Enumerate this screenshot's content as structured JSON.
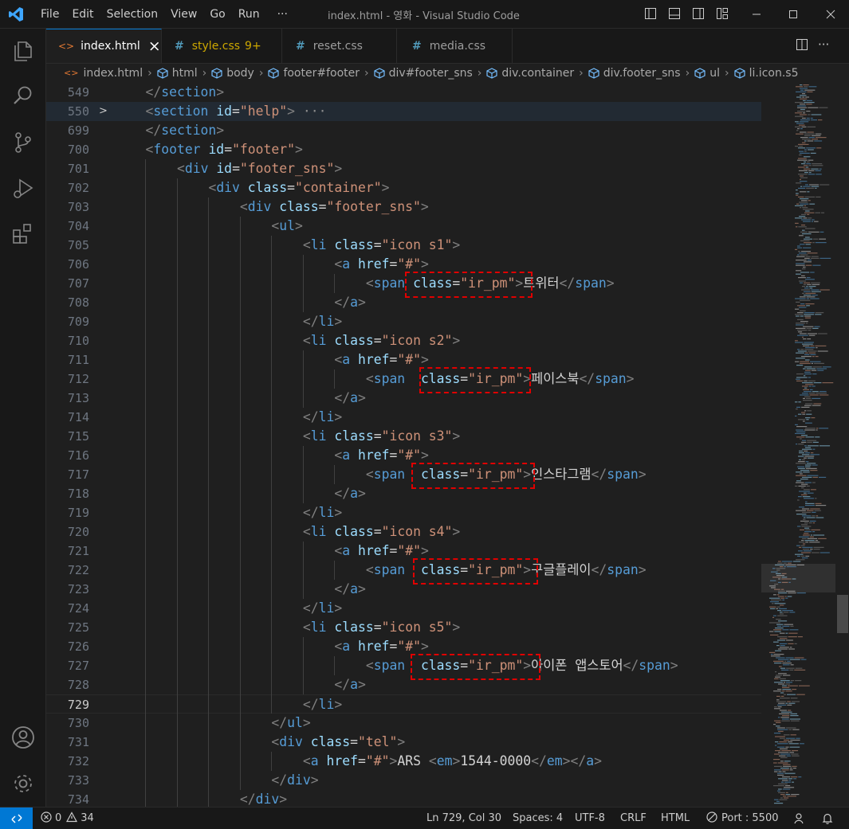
{
  "titlebar": {
    "menu": [
      "File",
      "Edit",
      "Selection",
      "View",
      "Go",
      "Run"
    ],
    "more": "···",
    "window_title": "index.html - 영화 - Visual Studio Code"
  },
  "tabs": [
    {
      "label": "index.html",
      "close": "×"
    },
    {
      "label": "style.css",
      "badge": "9+"
    },
    {
      "label": "reset.css"
    },
    {
      "label": "media.css"
    }
  ],
  "breadcrumb": [
    "index.html",
    "html",
    "body",
    "footer#footer",
    "div#footer_sns",
    "div.container",
    "div.footer_sns",
    "ul",
    "li.icon.s5"
  ],
  "editor": {
    "lines": [
      {
        "n": "549",
        "indent": 1,
        "code": [
          [
            "tg",
            "</"
          ],
          [
            "tn",
            "section"
          ],
          [
            "tg",
            ">"
          ]
        ]
      },
      {
        "n": "550",
        "indent": 1,
        "fold": ">",
        "cur": true,
        "code": [
          [
            "tg",
            "<"
          ],
          [
            "tn",
            "section"
          ],
          [
            "tx",
            " "
          ],
          [
            "at",
            "id"
          ],
          [
            "tx",
            "="
          ],
          [
            "st",
            "\"help\""
          ],
          [
            "tg",
            ">"
          ],
          [
            "el",
            " ···"
          ]
        ]
      },
      {
        "n": "699",
        "indent": 1,
        "code": [
          [
            "tg",
            "</"
          ],
          [
            "tn",
            "section"
          ],
          [
            "tg",
            ">"
          ]
        ]
      },
      {
        "n": "700",
        "indent": 1,
        "code": [
          [
            "tg",
            "<"
          ],
          [
            "tn",
            "footer"
          ],
          [
            "tx",
            " "
          ],
          [
            "at",
            "id"
          ],
          [
            "tx",
            "="
          ],
          [
            "st",
            "\"footer\""
          ],
          [
            "tg",
            ">"
          ]
        ]
      },
      {
        "n": "701",
        "indent": 2,
        "code": [
          [
            "tg",
            "<"
          ],
          [
            "tn",
            "div"
          ],
          [
            "tx",
            " "
          ],
          [
            "at",
            "id"
          ],
          [
            "tx",
            "="
          ],
          [
            "st",
            "\"footer_sns\""
          ],
          [
            "tg",
            ">"
          ]
        ]
      },
      {
        "n": "702",
        "indent": 3,
        "code": [
          [
            "tg",
            "<"
          ],
          [
            "tn",
            "div"
          ],
          [
            "tx",
            " "
          ],
          [
            "at",
            "class"
          ],
          [
            "tx",
            "="
          ],
          [
            "st",
            "\"container\""
          ],
          [
            "tg",
            ">"
          ]
        ]
      },
      {
        "n": "703",
        "indent": 4,
        "code": [
          [
            "tg",
            "<"
          ],
          [
            "tn",
            "div"
          ],
          [
            "tx",
            " "
          ],
          [
            "at",
            "class"
          ],
          [
            "tx",
            "="
          ],
          [
            "st",
            "\"footer_sns\""
          ],
          [
            "tg",
            ">"
          ]
        ]
      },
      {
        "n": "704",
        "indent": 5,
        "code": [
          [
            "tg",
            "<"
          ],
          [
            "tn",
            "ul"
          ],
          [
            "tg",
            ">"
          ]
        ]
      },
      {
        "n": "705",
        "indent": 6,
        "code": [
          [
            "tg",
            "<"
          ],
          [
            "tn",
            "li"
          ],
          [
            "tx",
            " "
          ],
          [
            "at",
            "class"
          ],
          [
            "tx",
            "="
          ],
          [
            "st",
            "\"icon s1\""
          ],
          [
            "tg",
            ">"
          ]
        ]
      },
      {
        "n": "706",
        "indent": 7,
        "code": [
          [
            "tg",
            "<"
          ],
          [
            "tn",
            "a"
          ],
          [
            "tx",
            " "
          ],
          [
            "at",
            "href"
          ],
          [
            "tx",
            "="
          ],
          [
            "st",
            "\"#\""
          ],
          [
            "tg",
            ">"
          ]
        ]
      },
      {
        "n": "707",
        "indent": 8,
        "code": [
          [
            "tg",
            "<"
          ],
          [
            "tn",
            "span"
          ],
          [
            "tx",
            " "
          ],
          [
            "at",
            "class"
          ],
          [
            "tx",
            "="
          ],
          [
            "st",
            "\"ir_pm\""
          ],
          [
            "tg",
            ">"
          ],
          [
            "tx",
            "트위터"
          ],
          [
            "tg",
            "</"
          ],
          [
            "tn",
            "span"
          ],
          [
            "tg",
            ">"
          ]
        ]
      },
      {
        "n": "708",
        "indent": 7,
        "code": [
          [
            "tg",
            "</"
          ],
          [
            "tn",
            "a"
          ],
          [
            "tg",
            ">"
          ]
        ]
      },
      {
        "n": "709",
        "indent": 6,
        "code": [
          [
            "tg",
            "</"
          ],
          [
            "tn",
            "li"
          ],
          [
            "tg",
            ">"
          ]
        ]
      },
      {
        "n": "710",
        "indent": 6,
        "code": [
          [
            "tg",
            "<"
          ],
          [
            "tn",
            "li"
          ],
          [
            "tx",
            " "
          ],
          [
            "at",
            "class"
          ],
          [
            "tx",
            "="
          ],
          [
            "st",
            "\"icon s2\""
          ],
          [
            "tg",
            ">"
          ]
        ]
      },
      {
        "n": "711",
        "indent": 7,
        "code": [
          [
            "tg",
            "<"
          ],
          [
            "tn",
            "a"
          ],
          [
            "tx",
            " "
          ],
          [
            "at",
            "href"
          ],
          [
            "tx",
            "="
          ],
          [
            "st",
            "\"#\""
          ],
          [
            "tg",
            ">"
          ]
        ]
      },
      {
        "n": "712",
        "indent": 8,
        "code": [
          [
            "tg",
            "<"
          ],
          [
            "tn",
            "span"
          ],
          [
            "tx",
            "  "
          ],
          [
            "at",
            "class"
          ],
          [
            "tx",
            "="
          ],
          [
            "st",
            "\"ir_pm\""
          ],
          [
            "tg",
            ">"
          ],
          [
            "tx",
            "페이스북"
          ],
          [
            "tg",
            "</"
          ],
          [
            "tn",
            "span"
          ],
          [
            "tg",
            ">"
          ]
        ]
      },
      {
        "n": "713",
        "indent": 7,
        "code": [
          [
            "tg",
            "</"
          ],
          [
            "tn",
            "a"
          ],
          [
            "tg",
            ">"
          ]
        ]
      },
      {
        "n": "714",
        "indent": 6,
        "code": [
          [
            "tg",
            "</"
          ],
          [
            "tn",
            "li"
          ],
          [
            "tg",
            ">"
          ]
        ]
      },
      {
        "n": "715",
        "indent": 6,
        "code": [
          [
            "tg",
            "<"
          ],
          [
            "tn",
            "li"
          ],
          [
            "tx",
            " "
          ],
          [
            "at",
            "class"
          ],
          [
            "tx",
            "="
          ],
          [
            "st",
            "\"icon s3\""
          ],
          [
            "tg",
            ">"
          ]
        ]
      },
      {
        "n": "716",
        "indent": 7,
        "code": [
          [
            "tg",
            "<"
          ],
          [
            "tn",
            "a"
          ],
          [
            "tx",
            " "
          ],
          [
            "at",
            "href"
          ],
          [
            "tx",
            "="
          ],
          [
            "st",
            "\"#\""
          ],
          [
            "tg",
            ">"
          ]
        ]
      },
      {
        "n": "717",
        "indent": 8,
        "code": [
          [
            "tg",
            "<"
          ],
          [
            "tn",
            "span"
          ],
          [
            "tx",
            "  "
          ],
          [
            "at",
            "class"
          ],
          [
            "tx",
            "="
          ],
          [
            "st",
            "\"ir_pm\""
          ],
          [
            "tg",
            ">"
          ],
          [
            "tx",
            "인스타그램"
          ],
          [
            "tg",
            "</"
          ],
          [
            "tn",
            "span"
          ],
          [
            "tg",
            ">"
          ]
        ]
      },
      {
        "n": "718",
        "indent": 7,
        "code": [
          [
            "tg",
            "</"
          ],
          [
            "tn",
            "a"
          ],
          [
            "tg",
            ">"
          ]
        ]
      },
      {
        "n": "719",
        "indent": 6,
        "code": [
          [
            "tg",
            "</"
          ],
          [
            "tn",
            "li"
          ],
          [
            "tg",
            ">"
          ]
        ]
      },
      {
        "n": "720",
        "indent": 6,
        "code": [
          [
            "tg",
            "<"
          ],
          [
            "tn",
            "li"
          ],
          [
            "tx",
            " "
          ],
          [
            "at",
            "class"
          ],
          [
            "tx",
            "="
          ],
          [
            "st",
            "\"icon s4\""
          ],
          [
            "tg",
            ">"
          ]
        ]
      },
      {
        "n": "721",
        "indent": 7,
        "code": [
          [
            "tg",
            "<"
          ],
          [
            "tn",
            "a"
          ],
          [
            "tx",
            " "
          ],
          [
            "at",
            "href"
          ],
          [
            "tx",
            "="
          ],
          [
            "st",
            "\"#\""
          ],
          [
            "tg",
            ">"
          ]
        ]
      },
      {
        "n": "722",
        "indent": 8,
        "code": [
          [
            "tg",
            "<"
          ],
          [
            "tn",
            "span"
          ],
          [
            "tx",
            "  "
          ],
          [
            "at",
            "class"
          ],
          [
            "tx",
            "="
          ],
          [
            "st",
            "\"ir_pm\""
          ],
          [
            "tg",
            ">"
          ],
          [
            "tx",
            "구글플레이"
          ],
          [
            "tg",
            "</"
          ],
          [
            "tn",
            "span"
          ],
          [
            "tg",
            ">"
          ]
        ]
      },
      {
        "n": "723",
        "indent": 7,
        "code": [
          [
            "tg",
            "</"
          ],
          [
            "tn",
            "a"
          ],
          [
            "tg",
            ">"
          ]
        ]
      },
      {
        "n": "724",
        "indent": 6,
        "code": [
          [
            "tg",
            "</"
          ],
          [
            "tn",
            "li"
          ],
          [
            "tg",
            ">"
          ]
        ]
      },
      {
        "n": "725",
        "indent": 6,
        "code": [
          [
            "tg",
            "<"
          ],
          [
            "tn",
            "li"
          ],
          [
            "tx",
            " "
          ],
          [
            "at",
            "class"
          ],
          [
            "tx",
            "="
          ],
          [
            "st",
            "\"icon s5\""
          ],
          [
            "tg",
            ">"
          ]
        ]
      },
      {
        "n": "726",
        "indent": 7,
        "code": [
          [
            "tg",
            "<"
          ],
          [
            "tn",
            "a"
          ],
          [
            "tx",
            " "
          ],
          [
            "at",
            "href"
          ],
          [
            "tx",
            "="
          ],
          [
            "st",
            "\"#\""
          ],
          [
            "tg",
            ">"
          ]
        ]
      },
      {
        "n": "727",
        "indent": 8,
        "code": [
          [
            "tg",
            "<"
          ],
          [
            "tn",
            "span"
          ],
          [
            "tx",
            "  "
          ],
          [
            "at",
            "class"
          ],
          [
            "tx",
            "="
          ],
          [
            "st",
            "\"ir_pm\""
          ],
          [
            "tg",
            ">"
          ],
          [
            "tx",
            "아이폰 앱스토어"
          ],
          [
            "tg",
            "</"
          ],
          [
            "tn",
            "span"
          ],
          [
            "tg",
            ">"
          ]
        ]
      },
      {
        "n": "728",
        "indent": 7,
        "code": [
          [
            "tg",
            "</"
          ],
          [
            "tn",
            "a"
          ],
          [
            "tg",
            ">"
          ]
        ]
      },
      {
        "n": "729",
        "indent": 6,
        "active": true,
        "code": [
          [
            "tg",
            "</"
          ],
          [
            "tn",
            "li"
          ],
          [
            "tg",
            ">"
          ]
        ]
      },
      {
        "n": "730",
        "indent": 5,
        "code": [
          [
            "tg",
            "</"
          ],
          [
            "tn",
            "ul"
          ],
          [
            "tg",
            ">"
          ]
        ]
      },
      {
        "n": "731",
        "indent": 5,
        "code": [
          [
            "tg",
            "<"
          ],
          [
            "tn",
            "div"
          ],
          [
            "tx",
            " "
          ],
          [
            "at",
            "class"
          ],
          [
            "tx",
            "="
          ],
          [
            "st",
            "\"tel\""
          ],
          [
            "tg",
            ">"
          ]
        ]
      },
      {
        "n": "732",
        "indent": 6,
        "code": [
          [
            "tg",
            "<"
          ],
          [
            "tn",
            "a"
          ],
          [
            "tx",
            " "
          ],
          [
            "at",
            "href"
          ],
          [
            "tx",
            "="
          ],
          [
            "st",
            "\"#\""
          ],
          [
            "tg",
            ">"
          ],
          [
            "tx",
            "ARS "
          ],
          [
            "tg",
            "<"
          ],
          [
            "tn",
            "em"
          ],
          [
            "tg",
            ">"
          ],
          [
            "tx",
            "1544-0000"
          ],
          [
            "tg",
            "</"
          ],
          [
            "tn",
            "em"
          ],
          [
            "tg",
            "></"
          ],
          [
            "tn",
            "a"
          ],
          [
            "tg",
            ">"
          ]
        ]
      },
      {
        "n": "733",
        "indent": 5,
        "code": [
          [
            "tg",
            "</"
          ],
          [
            "tn",
            "div"
          ],
          [
            "tg",
            ">"
          ]
        ]
      },
      {
        "n": "734",
        "indent": 4,
        "code": [
          [
            "tg",
            "</"
          ],
          [
            "tn",
            "div"
          ],
          [
            "tg",
            ">"
          ]
        ]
      }
    ]
  },
  "statusbar": {
    "errors": "0",
    "warnings": "34",
    "cursor": "Ln 729, Col 30",
    "spaces": "Spaces: 4",
    "encoding": "UTF-8",
    "eol": "CRLF",
    "language": "HTML",
    "port": "Port : 5500"
  },
  "colors": {
    "accent": "#0078d4",
    "highlight_box": "#e00000"
  }
}
